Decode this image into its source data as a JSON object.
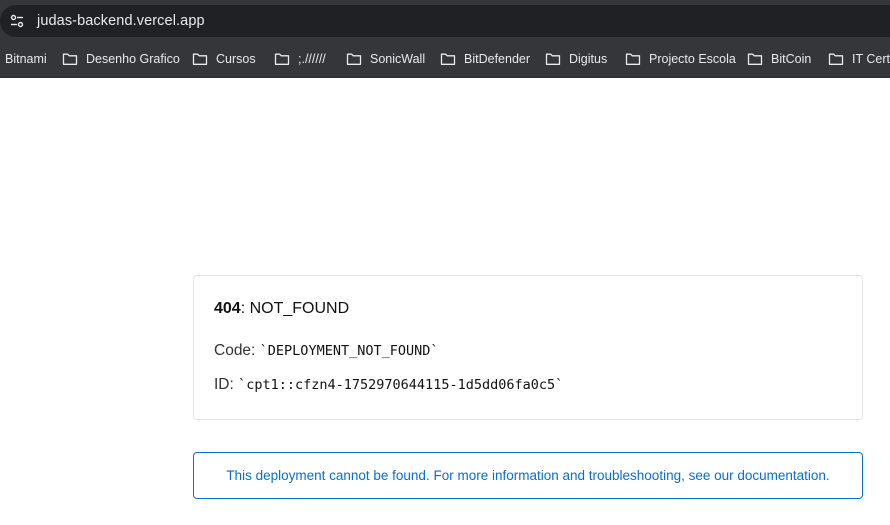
{
  "browser": {
    "url": "judas-backend.vercel.app",
    "bookmarks": [
      {
        "label": "Bitnami",
        "folder": false
      },
      {
        "label": "Desenho Grafico",
        "folder": true
      },
      {
        "label": "Cursos",
        "folder": true
      },
      {
        "label": ";.//////",
        "folder": true
      },
      {
        "label": "SonicWall",
        "folder": true
      },
      {
        "label": "BitDefender",
        "folder": true
      },
      {
        "label": "Digitus",
        "folder": true
      },
      {
        "label": "Projecto Escola",
        "folder": true
      },
      {
        "label": "BitCoin",
        "folder": true
      },
      {
        "label": "IT Certi",
        "folder": true
      }
    ]
  },
  "error": {
    "code_number": "404",
    "code_text": ": NOT_FOUND",
    "code_label": "Code: ",
    "code_value": "`DEPLOYMENT_NOT_FOUND`",
    "id_label": "ID: ",
    "id_value": "`cpt1::cfzn4-1752970644115-1d5dd06fa0c5`"
  },
  "info": {
    "message": "This deployment cannot be found. For more information and troubleshooting, see our documentation."
  },
  "colors": {
    "chrome_bg": "#35363a",
    "url_bg": "#202124",
    "link_blue": "#0a6ec8"
  }
}
